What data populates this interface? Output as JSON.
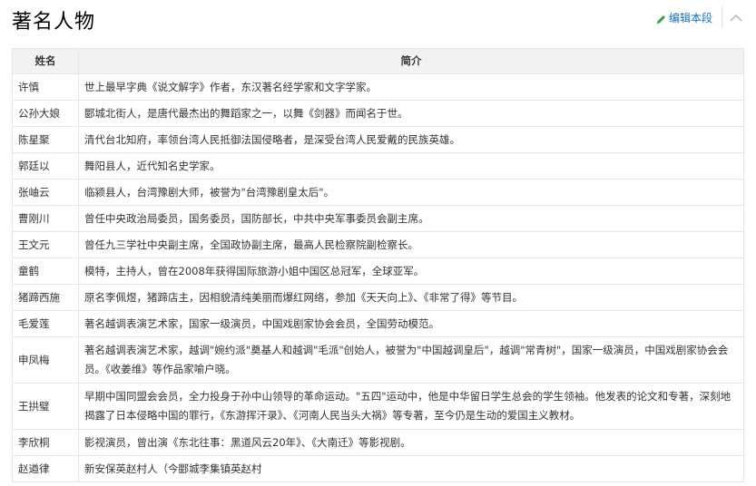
{
  "section": {
    "title": "著名人物",
    "edit_label": "编辑本段",
    "edit_icon": "pencil-icon",
    "collapse_icon": "chevron-up-icon",
    "accent_color": "#136ec2"
  },
  "table": {
    "headers": {
      "name": "姓名",
      "desc": "简介"
    },
    "rows": [
      {
        "name": "许慎",
        "desc": "世上最早字典《说文解字》作者，东汉著名经学家和文字学家。"
      },
      {
        "name": "公孙大娘",
        "desc": " 郾城北街人，是唐代最杰出的舞蹈家之一，以舞《剑器》而闻名于世。"
      },
      {
        "name": "陈星聚",
        "desc": "清代台北知府，率领台湾人民抵御法国侵略者，是深受台湾人民爱戴的民族英雄。"
      },
      {
        "name": "郭廷以",
        "desc": "舞阳县人，近代知名史学家。"
      },
      {
        "name": "张岫云",
        "desc": "临颍县人，台湾豫剧大师，被誉为\"台湾豫剧皇太后\"。"
      },
      {
        "name": "曹刚川",
        "desc": "曾任中央政治局委员，国务委员，国防部长，中共中央军事委员会副主席。"
      },
      {
        "name": "王文元",
        "desc": "曾任九三学社中央副主席，全国政协副主席，最高人民检察院副检察长。"
      },
      {
        "name": "童鹤",
        "desc": "模特，主持人，曾在2008年获得国际旅游小姐中国区总冠军，全球亚军。"
      },
      {
        "name": "猪蹄西施",
        "desc": "原名李佩煜，猪蹄店主，因相貌清纯美丽而爆红网络，参加《天天向上》、《非常了得》等节目。"
      },
      {
        "name": "毛爱莲",
        "desc": "著名越调表演艺术家，国家一级演员，中国戏剧家协会会员，全国劳动模范。"
      },
      {
        "name": "申凤梅",
        "desc": "著名越调表演艺术家，越调\"婉约派\"奠基人和越调\"毛派\"创始人，被誉为\"中国越调皇后\"，越调\"常青树\"，国家一级演员，中国戏剧家协会会员。《收姜维》等作品家喻户晓。"
      },
      {
        "name": "王拱璧",
        "desc": "早期中国同盟会会员，全力投身于孙中山领导的革命运动。\"五四\"运动中，他是中华留日学生总会的学生领袖。他发表的论文和专著，深刻地揭露了日本侵略中国的罪行，《东游挥汗录》、《河南人民当头大祸》等专著，至今仍是生动的爱国主义教材。"
      },
      {
        "name": "李欣桐",
        "desc": "影视演员，曾出演《东北往事：黑道风云20年》、《大南迁》等影视剧。"
      },
      {
        "name": "赵遒律",
        "desc": "新安保英赵村人（今郾城李集镇英赵村"
      }
    ]
  }
}
